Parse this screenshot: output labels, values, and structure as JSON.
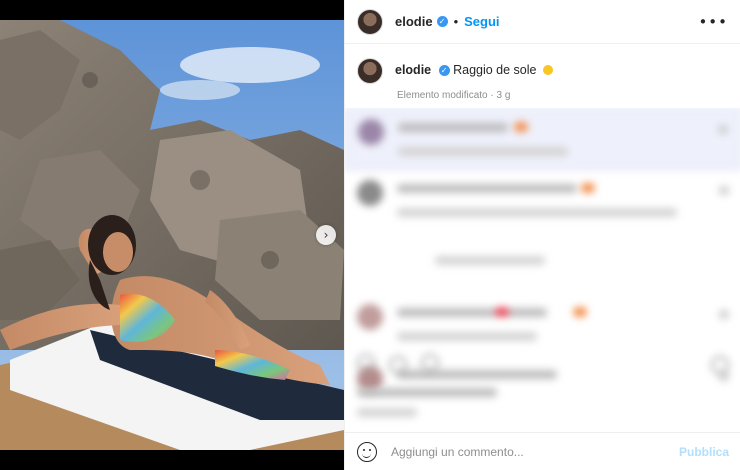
{
  "post": {
    "username": "elodie",
    "follow_label": "Segui",
    "separator": "•",
    "more_label": "•••",
    "caption_text": "Raggio de sole",
    "meta_text": "Elemento modificato · 3 g"
  },
  "media": {
    "next_label": "›"
  },
  "comment_box": {
    "placeholder": "Aggiungi un commento...",
    "publish_label": "Pubblica"
  },
  "colors": {
    "accent": "#0095f6",
    "publish_disabled": "#b2dffc",
    "verified": "#3897f0",
    "highlight_row": "#eef0fb"
  },
  "icons": [
    "verified-badge-icon",
    "more-options-icon",
    "next-arrow-icon",
    "emoji-icon",
    "sun-emoji-icon"
  ]
}
